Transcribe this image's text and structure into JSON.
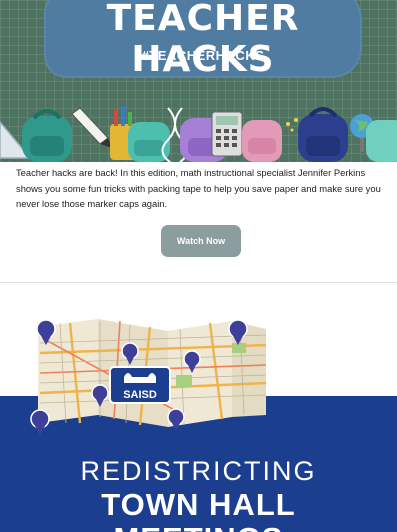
{
  "teacher_hacks": {
    "title": "TEACHER HACKS",
    "hashtag": "#TEACHERHACKS",
    "description": "Teacher hacks are back! In this edition, math instructional specialist Jennifer Perkins shows you some fun tricks with packing tape to help you save paper and make sure you never lose those marker caps again.",
    "button_label": "Watch Now"
  },
  "town_hall": {
    "logo_text": "SAISD",
    "line1": "REDISTRICTING",
    "line2": "TOWN HALL",
    "line3": "MEETINGS"
  },
  "colors": {
    "chalkboard": "#4e7360",
    "title_panel": "#4f7ca0",
    "button": "#8b9d9f",
    "banner_blue": "#1b3e8f"
  }
}
